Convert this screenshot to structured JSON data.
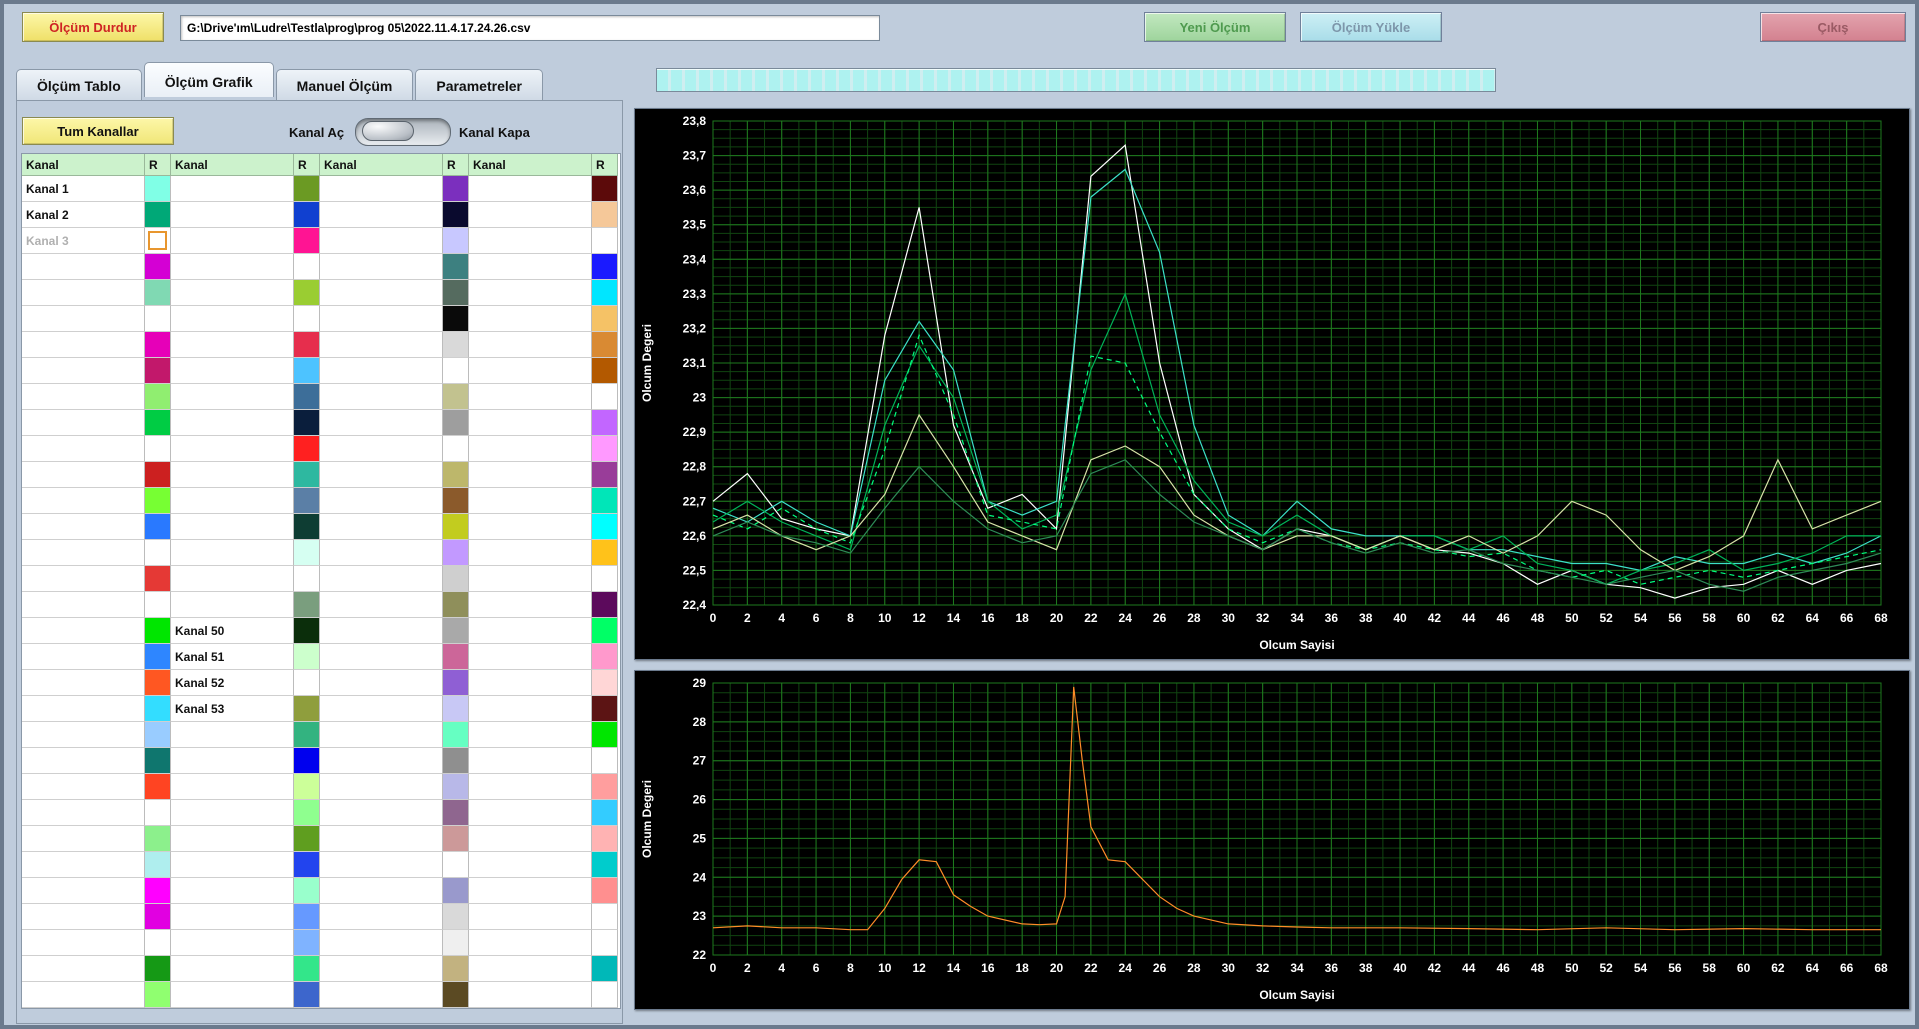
{
  "toolbar": {
    "stop_button": "Ölçüm Durdur",
    "file_path": "G:\\Drive'ım\\Ludre\\Testla\\prog\\prog 05\\2022.11.4.17.24.26.csv",
    "new_button": "Yeni Ölçüm",
    "load_button": "Ölçüm Yükle",
    "exit_button": "Çıkış"
  },
  "tabs": [
    {
      "label": "Ölçüm Tablo",
      "active": false
    },
    {
      "label": "Ölçüm Grafik",
      "active": true
    },
    {
      "label": "Manuel Ölçüm",
      "active": false
    },
    {
      "label": "Parametreler",
      "active": false
    }
  ],
  "colors": {
    "window_bg": "#bfccdc",
    "stop_button_bg": "#f4e878",
    "new_button_bg": "#a9d9a7",
    "load_button_bg": "#b5e2ec",
    "exit_button_bg": "#d98a96",
    "progress_segment": "#aef2f0",
    "table_header_bg": "#ccf2cc",
    "chart_bg": "#000000"
  },
  "channel_panel": {
    "all_channels_button": "Tum Kanallar",
    "toggle_on_label": "Kanal Aç",
    "toggle_off_label": "Kanal Kapa",
    "header_kanal": "Kanal",
    "header_r": "R",
    "rows": 32,
    "selected_cell": {
      "group": 0,
      "row": 2
    },
    "groups": [
      {
        "labels": {
          "0": "Kanal 1",
          "1": "Kanal 2",
          "2": "Kanal 3"
        },
        "disabled": [
          2
        ],
        "swatches": [
          "#80FFE6",
          "#00A877",
          "#FFFFFF",
          "#D400D4",
          "#80D9B3",
          "#FFFFFF",
          "#E600B8",
          "#C2186B",
          "#90EE70",
          "#00CC44",
          "#FFFFFF",
          "#CC2020",
          "#77FF33",
          "#2979FF",
          "#FFFFFF",
          "#E53935",
          "#FFFFFF",
          "#00E600",
          "#2E86FF",
          "#FF5722",
          "#33DDFF",
          "#99CCFF",
          "#0F766E",
          "#FF4422",
          "#FFFFFF",
          "#8CF08C",
          "#AFEEEE",
          "#FF00FF",
          "#E100E1",
          "#FFFFFF",
          "#159915",
          "#90FF70"
        ]
      },
      {
        "labels": {
          "17": "Kanal 50",
          "18": "Kanal 51",
          "19": "Kanal 52",
          "20": "Kanal 53"
        },
        "disabled": [],
        "swatches": [
          "#6B9A23",
          "#1040D0",
          "#FF1493",
          "#FFFFFF",
          "#9ACD32",
          "#FFFFFF",
          "#E62E4D",
          "#4DC3FF",
          "#3D6E99",
          "#0A1E3C",
          "#FF2020",
          "#2EB8A0",
          "#5B7FA6",
          "#0E3D33",
          "#D6FFF2",
          "#FFFFFF",
          "#7A9E7E",
          "#0B2E0B",
          "#CCFFCC",
          "#FFFFFF",
          "#8F9E3D",
          "#33B380",
          "#0000EE",
          "#CCFF99",
          "#8FFF8F",
          "#5F9E1F",
          "#2244EE",
          "#99FFCC",
          "#6699FF",
          "#7FB3FF",
          "#33E68A",
          "#3D66CC"
        ]
      },
      {
        "labels": {},
        "disabled": [],
        "swatches": [
          "#7B2FBE",
          "#0A0A2E",
          "#C8C8FF",
          "#3D8080",
          "#556B5F",
          "#0A0A0A",
          "#D9D9D9",
          "#FFFFFF",
          "#C2C28F",
          "#9E9E9E",
          "#FFFFFF",
          "#BDB76B",
          "#8B5A2B",
          "#C2CC1F",
          "#C299FF",
          "#CFCFCF",
          "#8F8F5B",
          "#A9A9A9",
          "#CC6699",
          "#8F5FD4",
          "#C8C8F5",
          "#66FFC2",
          "#8F8F8F",
          "#B8B8E8",
          "#8F668F",
          "#CC9999",
          "#FFFFFF",
          "#9999CC",
          "#D9D9D9",
          "#EFEFEF",
          "#C2B280",
          "#5B4A23"
        ]
      },
      {
        "labels": {},
        "disabled": [],
        "swatches": [
          "#5C0A0A",
          "#F5C899",
          "#FFFFFF",
          "#1A1AFF",
          "#00E6FF",
          "#F5C266",
          "#D98A33",
          "#B35900",
          "#FFFFFF",
          "#C266FF",
          "#FF99FF",
          "#993D99",
          "#00E6B8",
          "#00FFFF",
          "#FFC21A",
          "#FFFFFF",
          "#5C0A5C",
          "#00FF66",
          "#FF99CC",
          "#FFD6D6",
          "#5C1414",
          "#00E600",
          "#FFFFFF",
          "#FF9E9E",
          "#33CCFF",
          "#FFB3B3",
          "#00CCCC",
          "#FF8F8F",
          "#FFFFFF",
          "#FFFFFF",
          "#00B8B8",
          "#FFFFFF"
        ]
      }
    ]
  },
  "chart_data": [
    {
      "type": "line",
      "title": "",
      "xlabel": "Olcum Sayisi",
      "ylabel": "Olcum Degeri",
      "xlim": [
        0,
        68
      ],
      "ylim": [
        22.4,
        23.8
      ],
      "grid": {
        "x_minor": 1,
        "x_major": 2,
        "y_minor": 0.025,
        "y_major": 0.1,
        "minor_color": "#114411",
        "major_color": "#1e7a1e"
      },
      "background": "#000000",
      "x_ticks": {
        "values": [
          0,
          2,
          4,
          6,
          8,
          10,
          12,
          14,
          16,
          18,
          20,
          22,
          24,
          26,
          28,
          30,
          32,
          34,
          36,
          38,
          40,
          42,
          44,
          46,
          48,
          50,
          52,
          54,
          56,
          58,
          60,
          62,
          64,
          66,
          68
        ],
        "labels": [
          "0",
          "2",
          "4",
          "6",
          "8",
          "10",
          "12",
          "14",
          "16",
          "18",
          "20",
          "22",
          "24",
          "26",
          "28",
          "30",
          "32",
          "34",
          "36",
          "38",
          "40",
          "42",
          "44",
          "46",
          "48",
          "50",
          "52",
          "54",
          "56",
          "58",
          "60",
          "62",
          "64",
          "66",
          "68"
        ]
      },
      "y_ticks": {
        "values": [
          22.4,
          22.5,
          22.6,
          22.7,
          22.8,
          22.9,
          23.0,
          23.1,
          23.2,
          23.3,
          23.4,
          23.5,
          23.6,
          23.7,
          23.8
        ],
        "labels": [
          "22,4",
          "22,5",
          "22,6",
          "22,7",
          "22,8",
          "22,9",
          "23",
          "23,1",
          "23,2",
          "23,3",
          "23,4",
          "23,5",
          "23,6",
          "23,7",
          "23,8"
        ]
      },
      "x": [
        0,
        2,
        4,
        6,
        8,
        10,
        12,
        14,
        16,
        18,
        20,
        22,
        24,
        26,
        28,
        30,
        32,
        34,
        36,
        38,
        40,
        42,
        44,
        46,
        48,
        50,
        52,
        54,
        56,
        58,
        60,
        62,
        64,
        66,
        68
      ],
      "series": [
        {
          "name": "line-1",
          "color": "#FFFFFF",
          "values": [
            22.7,
            22.78,
            22.65,
            22.62,
            22.6,
            23.18,
            23.55,
            22.92,
            22.68,
            22.72,
            22.62,
            23.64,
            23.73,
            23.1,
            22.72,
            22.62,
            22.56,
            22.62,
            22.6,
            22.56,
            22.6,
            22.56,
            22.55,
            22.52,
            22.46,
            22.5,
            22.46,
            22.45,
            22.42,
            22.45,
            22.46,
            22.5,
            22.46,
            22.5,
            22.52
          ]
        },
        {
          "name": "line-2",
          "color": "#3CE0C8",
          "values": [
            22.68,
            22.64,
            22.7,
            22.64,
            22.6,
            23.05,
            23.22,
            23.08,
            22.7,
            22.66,
            22.7,
            23.58,
            23.66,
            23.42,
            22.92,
            22.66,
            22.6,
            22.7,
            22.62,
            22.6,
            22.6,
            22.6,
            22.56,
            22.56,
            22.54,
            22.52,
            22.52,
            22.5,
            22.54,
            22.52,
            22.52,
            22.55,
            22.52,
            22.55,
            22.6
          ]
        },
        {
          "name": "line-3",
          "color": "#00B358",
          "values": [
            22.64,
            22.7,
            22.64,
            22.6,
            22.56,
            22.92,
            23.15,
            23.0,
            22.7,
            22.62,
            22.66,
            23.08,
            23.3,
            22.95,
            22.76,
            22.64,
            22.6,
            22.66,
            22.6,
            22.56,
            22.6,
            22.6,
            22.56,
            22.6,
            22.52,
            22.5,
            22.46,
            22.5,
            22.52,
            22.56,
            22.5,
            22.52,
            22.55,
            22.6,
            22.6
          ]
        },
        {
          "name": "line-4",
          "color": "#00FF7F",
          "dash": "5,4",
          "values": [
            22.66,
            22.62,
            22.68,
            22.62,
            22.58,
            22.85,
            23.18,
            22.95,
            22.66,
            22.64,
            22.62,
            23.12,
            23.1,
            22.9,
            22.72,
            22.62,
            22.58,
            22.62,
            22.58,
            22.56,
            22.58,
            22.56,
            22.54,
            22.55,
            22.5,
            22.48,
            22.5,
            22.46,
            22.48,
            22.5,
            22.48,
            22.5,
            22.52,
            22.54,
            22.56
          ]
        },
        {
          "name": "line-5",
          "color": "#D8E2A8",
          "values": [
            22.62,
            22.66,
            22.6,
            22.56,
            22.6,
            22.72,
            22.95,
            22.8,
            22.64,
            22.6,
            22.56,
            22.82,
            22.86,
            22.8,
            22.66,
            22.6,
            22.56,
            22.6,
            22.6,
            22.56,
            22.6,
            22.56,
            22.6,
            22.55,
            22.6,
            22.7,
            22.66,
            22.56,
            22.5,
            22.54,
            22.6,
            22.82,
            22.62,
            22.66,
            22.7
          ]
        },
        {
          "name": "line-6",
          "color": "#2E8B57",
          "values": [
            22.6,
            22.64,
            22.6,
            22.58,
            22.55,
            22.68,
            22.8,
            22.7,
            22.62,
            22.58,
            22.6,
            22.78,
            22.82,
            22.72,
            22.64,
            22.6,
            22.56,
            22.62,
            22.58,
            22.55,
            22.58,
            22.55,
            22.56,
            22.52,
            22.5,
            22.48,
            22.46,
            22.48,
            22.5,
            22.46,
            22.44,
            22.48,
            22.5,
            22.52,
            22.55
          ]
        }
      ]
    },
    {
      "type": "line",
      "title": "",
      "xlabel": "Olcum Sayisi",
      "ylabel": "Olcum Degeri",
      "xlim": [
        0,
        68
      ],
      "ylim": [
        22,
        29
      ],
      "grid": {
        "x_minor": 1,
        "x_major": 2,
        "y_minor": 0.25,
        "y_major": 1,
        "minor_color": "#114411",
        "major_color": "#1e7a1e"
      },
      "background": "#000000",
      "x_ticks": {
        "values": [
          0,
          2,
          4,
          6,
          8,
          10,
          12,
          14,
          16,
          18,
          20,
          22,
          24,
          26,
          28,
          30,
          32,
          34,
          36,
          38,
          40,
          42,
          44,
          46,
          48,
          50,
          52,
          54,
          56,
          58,
          60,
          62,
          64,
          66,
          68
        ],
        "labels": [
          "0",
          "2",
          "4",
          "6",
          "8",
          "10",
          "12",
          "14",
          "16",
          "18",
          "20",
          "22",
          "24",
          "26",
          "28",
          "30",
          "32",
          "34",
          "36",
          "38",
          "40",
          "42",
          "44",
          "46",
          "48",
          "50",
          "52",
          "54",
          "56",
          "58",
          "60",
          "62",
          "64",
          "66",
          "68"
        ]
      },
      "y_ticks": {
        "values": [
          22,
          23,
          24,
          25,
          26,
          27,
          28,
          29
        ],
        "labels": [
          "22",
          "23",
          "24",
          "25",
          "26",
          "27",
          "28",
          "29"
        ]
      },
      "series": [
        {
          "name": "line-orange",
          "color": "#FF8C28",
          "x": [
            0,
            2,
            4,
            6,
            8,
            9,
            10,
            11,
            12,
            13,
            14,
            15,
            16,
            18,
            19,
            20,
            20.5,
            21,
            21.5,
            22,
            23,
            24,
            25,
            26,
            27,
            28,
            30,
            32,
            34,
            36,
            38,
            40,
            44,
            48,
            52,
            56,
            60,
            64,
            68
          ],
          "values": [
            22.7,
            22.75,
            22.7,
            22.7,
            22.65,
            22.65,
            23.2,
            23.95,
            24.45,
            24.4,
            23.55,
            23.25,
            23.0,
            22.8,
            22.78,
            22.8,
            23.5,
            28.9,
            27.0,
            25.3,
            24.45,
            24.4,
            23.95,
            23.5,
            23.2,
            23.0,
            22.8,
            22.75,
            22.72,
            22.7,
            22.7,
            22.7,
            22.68,
            22.65,
            22.7,
            22.65,
            22.68,
            22.65,
            22.65
          ]
        }
      ]
    }
  ]
}
